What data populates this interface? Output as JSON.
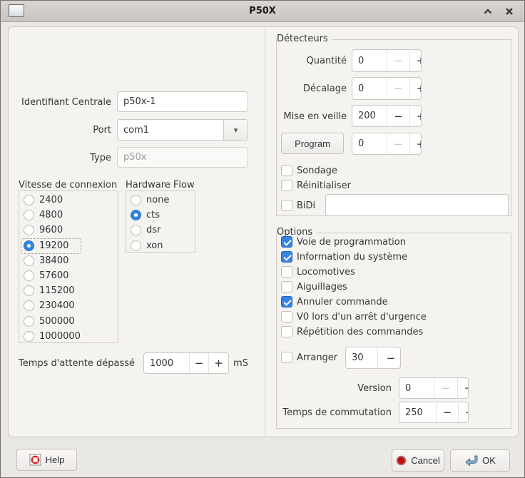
{
  "titlebar": {
    "title": "P50X"
  },
  "glyphs": {
    "minus": "−",
    "plus": "+",
    "dropdown": "▾"
  },
  "left": {
    "identifiant": {
      "label": "Identifiant Centrale",
      "value": "p50x-1"
    },
    "port": {
      "label": "Port",
      "value": "com1"
    },
    "type": {
      "label": "Type",
      "value": "p50x"
    },
    "speed": {
      "label": "Vitesse de connexion",
      "selected": "19200",
      "options": [
        "2400",
        "4800",
        "9600",
        "19200",
        "38400",
        "57600",
        "115200",
        "230400",
        "500000",
        "1000000"
      ]
    },
    "flow": {
      "label": "Hardware Flow",
      "selected": "cts",
      "options": [
        "none",
        "cts",
        "dsr",
        "xon"
      ]
    },
    "timeout": {
      "label": "Temps d'attente dépassé",
      "value": "1000",
      "unit": "mS"
    }
  },
  "detectors": {
    "title": "Détecteurs",
    "quantity": {
      "label": "Quantité",
      "value": "0"
    },
    "offset": {
      "label": "Décalage",
      "value": "0"
    },
    "sleep": {
      "label": "Mise en veille",
      "value": "200"
    },
    "program": {
      "button": "Program",
      "value": "0"
    },
    "sondage": {
      "label": "Sondage",
      "checked": false
    },
    "reinitialiser": {
      "label": "Réinitialiser",
      "checked": false
    },
    "bidi": {
      "label": "BiDi",
      "checked": false,
      "value": ""
    }
  },
  "options": {
    "title": "Options",
    "checks": [
      {
        "label": "Voie de programmation",
        "checked": true
      },
      {
        "label": "Information du système",
        "checked": true
      },
      {
        "label": "Locomotives",
        "checked": false
      },
      {
        "label": "Aiguillages",
        "checked": false
      },
      {
        "label": "Annuler commande",
        "checked": true
      },
      {
        "label": "V0 lors d'un arrêt d'urgence",
        "checked": false
      },
      {
        "label": "Répétition des commandes",
        "checked": false
      }
    ],
    "arranger": {
      "label": "Arranger",
      "checked": false,
      "value": "30"
    },
    "version": {
      "label": "Version",
      "value": "0"
    },
    "commutation": {
      "label": "Temps de commutation",
      "value": "250"
    }
  },
  "footer": {
    "help": "Help",
    "cancel": "Cancel",
    "ok": "OK"
  },
  "colors": {
    "accent": "#3584e4",
    "cancel_red": "#c00d0d",
    "ok_blue": "#8fb3d4"
  }
}
